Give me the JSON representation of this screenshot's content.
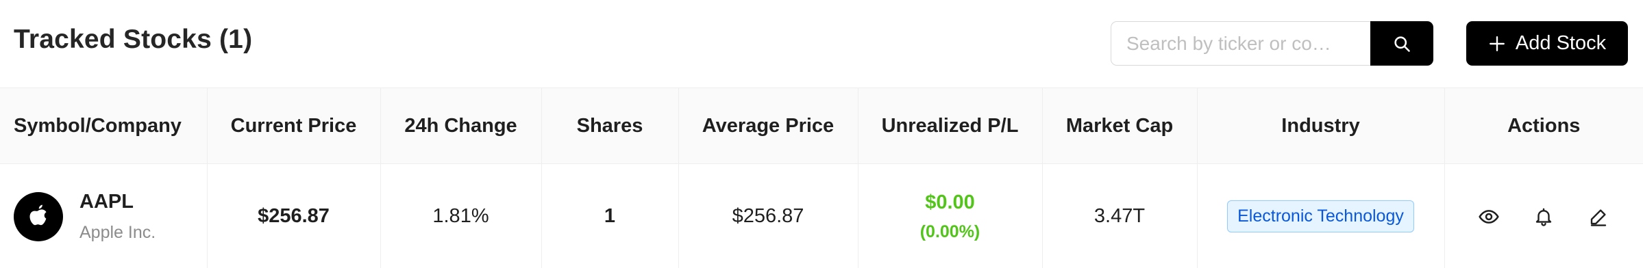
{
  "header": {
    "title": "Tracked Stocks (1)",
    "search_placeholder": "Search by ticker or co…",
    "add_label": "Add Stock"
  },
  "table": {
    "columns": [
      "Symbol/Company",
      "Current Price",
      "24h Change",
      "Shares",
      "Average Price",
      "Unrealized P/L",
      "Market Cap",
      "Industry",
      "Actions"
    ],
    "rows": [
      {
        "ticker": "AAPL",
        "company": "Apple Inc.",
        "current_price": "$256.87",
        "change_24h": "1.81%",
        "shares": "1",
        "average_price": "$256.87",
        "unrealized_pl": "$0.00",
        "unrealized_pl_pct": "(0.00%)",
        "market_cap": "3.47T",
        "industry": "Electronic Technology"
      }
    ]
  },
  "icons": {
    "search": "search-icon",
    "add": "plus-icon",
    "logo": "apple-logo-icon",
    "view": "eye-icon",
    "alert": "bell-icon",
    "edit": "edit-icon"
  },
  "colors": {
    "positive": "#52c41a",
    "primary_button": "#000000",
    "tag_bg": "#e6f4ff",
    "tag_border": "#91caff",
    "tag_text": "#0958d9"
  }
}
